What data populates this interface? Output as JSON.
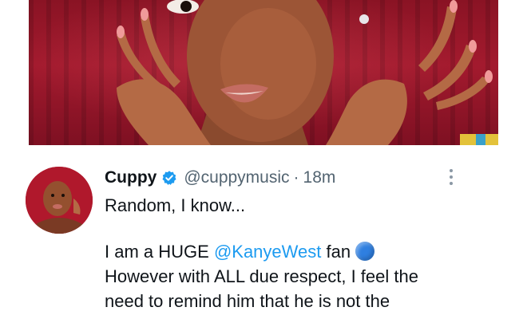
{
  "tweet": {
    "author_name": "Cuppy",
    "handle": "@cuppymusic",
    "separator": "·",
    "time": "18m",
    "lines": [
      "Random, I know...",
      "I am a HUGE",
      "However with ALL due respect, I feel the",
      "need to remind him that he is not the"
    ],
    "mention": "@KanyeWest",
    "after_mention": " fan",
    "emoji": "blue-circle"
  },
  "icons": {
    "verified": "verified-badge-icon",
    "more": "more-options-icon"
  },
  "colors": {
    "link": "#1d9bf0",
    "verified": "#1d9bf0",
    "secondary_text": "#536471",
    "primary_text": "#0f1419",
    "photo_background": "#a31a2e"
  }
}
